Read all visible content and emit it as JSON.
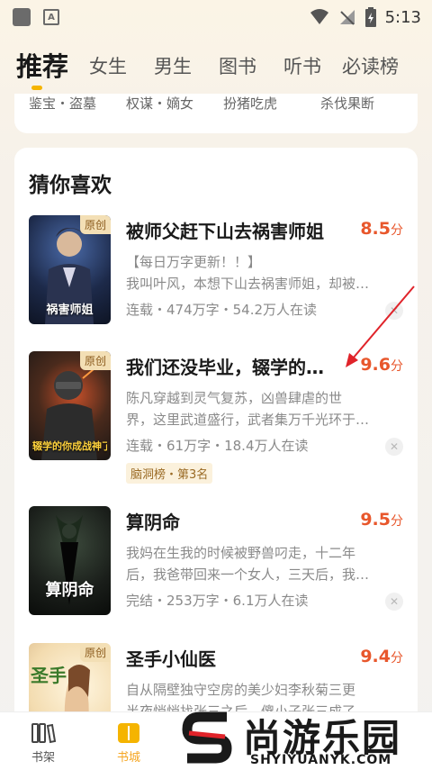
{
  "status_bar": {
    "time": "5:13",
    "a_icon": "A"
  },
  "tabs": [
    {
      "label": "推荐",
      "active": true
    },
    {
      "label": "女生"
    },
    {
      "label": "男生"
    },
    {
      "label": "图书"
    },
    {
      "label": "听书"
    },
    {
      "label": "必读榜"
    }
  ],
  "categories": [
    "鉴宝・盗墓",
    "权谋・嫡女",
    "扮猪吃虎",
    "杀伐果断"
  ],
  "section_title": "猜你喜欢",
  "books": [
    {
      "badge": "原创",
      "cover_title": "祸害师姐",
      "title": "被师父赶下山去祸害师姐",
      "score": "8.5",
      "score_unit": "分",
      "desc1": "【每日万字更新！！】",
      "desc2": "我叫叶风，本想下山去祸害师姐，却被…",
      "meta": "连载・474万字・54.2万人在读"
    },
    {
      "badge": "原创",
      "cover_title": "辍学的你成战神了",
      "title": "我们还没毕业，辍学的…",
      "score": "9.6",
      "score_unit": "分",
      "desc1": "陈凡穿越到灵气复苏，凶兽肆虐的世",
      "desc2": "界，这里武道盛行，武者集万千光环于…",
      "meta": "连载・61万字・18.4万人在读",
      "rank": "脑洞榜・第3名"
    },
    {
      "cover_title": "算阴命",
      "title": "算阴命",
      "score": "9.5",
      "score_unit": "分",
      "desc1": "我妈在生我的时候被野兽叼走，十二年",
      "desc2": "后，我爸带回来一个女人，三天后，我…",
      "meta": "完结・253万字・6.1万人在读"
    },
    {
      "badge": "原创",
      "cover_title": "圣手",
      "title": "圣手小仙医",
      "score": "9.4",
      "score_unit": "分",
      "desc1": "自从隔壁独守空房的美少妇李秋菊三更",
      "desc2": "半夜悄悄找张三之后，傻小子张三成了"
    }
  ],
  "bottom_nav": [
    {
      "label": "书架",
      "icon": "bookshelf-icon"
    },
    {
      "label": "书城",
      "icon": "bookstore-icon",
      "active": true
    }
  ],
  "watermark": {
    "text": "尚游乐园",
    "url": "SHYIYUANYK.COM"
  },
  "colors": {
    "accent": "#f5b400",
    "score": "#e8572c",
    "arrow": "#e0232a"
  }
}
